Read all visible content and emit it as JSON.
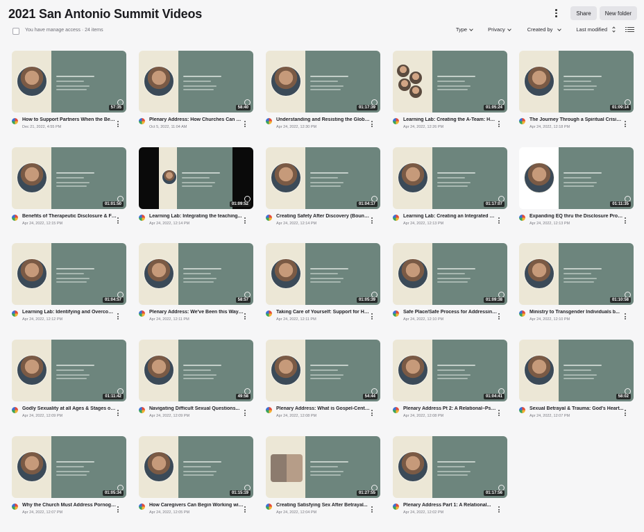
{
  "header": {
    "title": "2021 San Antonio Summit Videos",
    "share_label": "Share",
    "new_folder_label": "New folder"
  },
  "toolbar": {
    "access_text": "You have manage access · 24 items",
    "filters": {
      "type": "Type",
      "privacy": "Privacy",
      "created_by": "Created by",
      "sort": "Last modified"
    }
  },
  "videos": [
    {
      "title": "How to Support Partners When the Betrayal...",
      "date": "Dec 21, 2022, 4:55 PM",
      "duration": "57:35",
      "style": "single"
    },
    {
      "title": "Plenary Address: How Churches Can Become...",
      "date": "Oct 5, 2022, 11:04 AM",
      "duration": "58:40",
      "style": "single"
    },
    {
      "title": "Understanding and Resisting the Global Sexual...",
      "date": "Apr 24, 2022, 12:30 PM",
      "duration": "01:17:39",
      "style": "single"
    },
    {
      "title": "Learning Lab: Creating the A-Team: How...",
      "date": "Apr 24, 2022, 12:26 PM",
      "duration": "01:05:24",
      "style": "multi"
    },
    {
      "title": "The Journey Through a Spiritual Crisis After...",
      "date": "Apr 24, 2022, 12:18 PM",
      "duration": "01:09:14",
      "style": "single"
    },
    {
      "title": "Benefits of Therapeutic Disclosure & Formal...",
      "date": "Apr 24, 2022, 12:15 PM",
      "duration": "01:01:50",
      "style": "couple"
    },
    {
      "title": "Learning Lab: Integrating the teaching...",
      "date": "Apr 24, 2022, 12:14 PM",
      "duration": "01:09:52",
      "style": "dark"
    },
    {
      "title": "Creating Safety After Discovery (Boundaries)...",
      "date": "Apr 24, 2022, 12:14 PM",
      "duration": "01:04:17",
      "style": "single"
    },
    {
      "title": "Learning Lab: Creating an Integrated Care...",
      "date": "Apr 24, 2022, 12:13 PM",
      "duration": "01:17:07",
      "style": "single"
    },
    {
      "title": "Expanding EQ thru the Disclosure Process...",
      "date": "Apr 24, 2022, 12:13 PM",
      "duration": "01:11:35",
      "style": "white"
    },
    {
      "title": "Learning Lab: Identifying and Overcoming...",
      "date": "Apr 24, 2022, 12:12 PM",
      "duration": "01:04:57",
      "style": "single"
    },
    {
      "title": "Plenary Address: We've Been this Way Before...",
      "date": "Apr 24, 2022, 12:11 PM",
      "duration": "58:57",
      "style": "single"
    },
    {
      "title": "Taking Care of Yourself: Support for Helpers...",
      "date": "Apr 24, 2022, 12:11 PM",
      "duration": "01:05:39",
      "style": "single"
    },
    {
      "title": "Safe Place/Safe Process for Addressing...",
      "date": "Apr 24, 2022, 12:10 PM",
      "duration": "01:09:38",
      "style": "single"
    },
    {
      "title": "Ministry to Transgender Individuals b...",
      "date": "Apr 24, 2022, 12:10 PM",
      "duration": "01:10:58",
      "style": "single"
    },
    {
      "title": "Godly Sexuality at all Ages & Stages of Life",
      "date": "Apr 24, 2022, 12:09 PM",
      "duration": "01:11:42",
      "style": "single"
    },
    {
      "title": "Navigating Difficult Sexual Questions...",
      "date": "Apr 24, 2022, 12:09 PM",
      "duration": "49:58",
      "style": "single"
    },
    {
      "title": "Plenary Address: What is Gospel-Centered...",
      "date": "Apr 24, 2022, 12:08 PM",
      "duration": "54:44",
      "style": "single"
    },
    {
      "title": "Plenary Address Pt 2: A Relational–Psych...",
      "date": "Apr 24, 2022, 12:08 PM",
      "duration": "01:04:41",
      "style": "single"
    },
    {
      "title": "Sexual Betrayal & Trauma: God's Heart...",
      "date": "Apr 24, 2022, 12:07 PM",
      "duration": "58:02",
      "style": "single"
    },
    {
      "title": "Why the Church Must Address Pornography...",
      "date": "Apr 24, 2022, 12:07 PM",
      "duration": "01:05:34",
      "style": "single"
    },
    {
      "title": "How Caregivers Can Begin Working with...",
      "date": "Apr 24, 2022, 12:05 PM",
      "duration": "01:15:19",
      "style": "single"
    },
    {
      "title": "Creating Satisfying Sex After Betrayal...",
      "date": "Apr 24, 2022, 12:04 PM",
      "duration": "01:27:55",
      "style": "pair"
    },
    {
      "title": "Plenary Address Part 1: A Relational...",
      "date": "Apr 24, 2022, 12:02 PM",
      "duration": "01:17:56",
      "style": "single"
    }
  ]
}
